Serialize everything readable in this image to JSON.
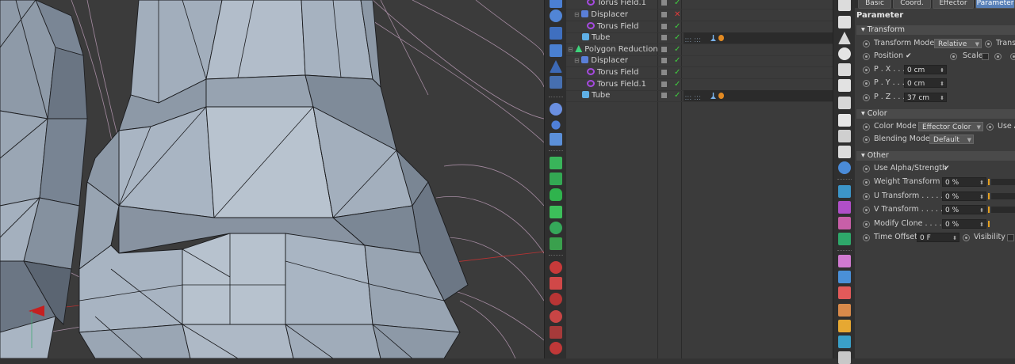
{
  "objects": [
    {
      "label": "Torus Field.1",
      "icon": "torus-icon",
      "status": "check"
    },
    {
      "label": "Displacer",
      "icon": "displacer-icon",
      "status": "cross"
    },
    {
      "label": "Torus Field",
      "icon": "torus-icon",
      "status": "check"
    },
    {
      "label": "Tube",
      "icon": "tube-icon",
      "status": "check",
      "tags": true
    },
    {
      "label": "Polygon Reduction",
      "icon": "polygon-reduction-icon",
      "status": "check"
    },
    {
      "label": "Displacer",
      "icon": "displacer-icon",
      "status": "check"
    },
    {
      "label": "Torus Field",
      "icon": "torus-icon",
      "status": "check"
    },
    {
      "label": "Torus Field.1",
      "icon": "torus-icon",
      "status": "check"
    },
    {
      "label": "Tube",
      "icon": "tube-icon",
      "status": "check",
      "tags": true
    }
  ],
  "attributes": {
    "tabs": [
      "Basic",
      "Coord.",
      "Effector",
      "Parameter"
    ],
    "active_tab": "Parameter",
    "heading": "Parameter",
    "transform": {
      "section": "Transform",
      "mode_label": "Transform Mode",
      "mode_value": "Relative",
      "trans_label": "Trans",
      "position_label": "Position",
      "position_checked": true,
      "scale_label": "Scale",
      "px_label": "P . X . . . .",
      "px_value": "0 cm",
      "py_label": "P . Y . . . .",
      "py_value": "0 cm",
      "pz_label": "P . Z . . . .",
      "pz_value": "37 cm"
    },
    "color": {
      "section": "Color",
      "mode_label": "Color Mode",
      "mode_value": "Effector Color",
      "use_label": "Use A",
      "blending_label": "Blending Mode",
      "blending_value": "Default"
    },
    "other": {
      "section": "Other",
      "alpha_label": "Use Alpha/Strength",
      "alpha_checked": true,
      "weight_label": "Weight Transform",
      "weight_value": "0 %",
      "u_label": "U Transform . . . . . .",
      "u_value": "0 %",
      "v_label": "V Transform . . . . . .",
      "v_value": "0 %",
      "clone_label": "Modify Clone . . . . .",
      "clone_value": "0 %",
      "time_label": "Time Offset",
      "time_value": "0 F",
      "visibility_label": "Visibility"
    }
  },
  "colors": {
    "accent": "#5880b8",
    "check": "#3fd03f",
    "cross": "#e03a3a",
    "mesh": "#9fadbd"
  }
}
